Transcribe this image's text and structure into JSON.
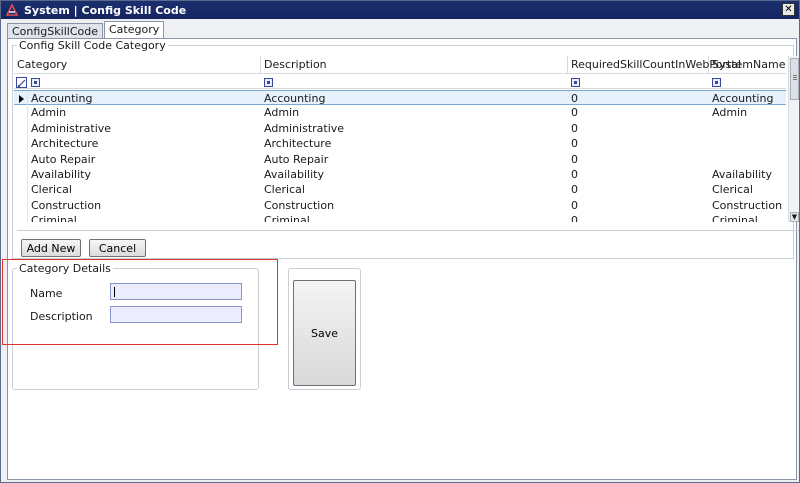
{
  "window": {
    "title": "System | Config Skill Code",
    "close_label": "✕"
  },
  "tabs": [
    {
      "label": "ConfigSkillCode"
    },
    {
      "label": "Category"
    }
  ],
  "grid_group": {
    "legend": "Config Skill Code Category",
    "columns": [
      "Category",
      "Description",
      "RequiredSkillCountInWebPortal",
      "SystemName"
    ],
    "rows": [
      [
        "Accounting",
        "Accounting",
        "0",
        "Accounting"
      ],
      [
        "Admin",
        "Admin",
        "0",
        "Admin"
      ],
      [
        "Administrative",
        "Administrative",
        "0",
        ""
      ],
      [
        "Architecture",
        "Architecture",
        "0",
        ""
      ],
      [
        "Auto Repair",
        "Auto Repair",
        "0",
        ""
      ],
      [
        "Availability",
        "Availability",
        "0",
        "Availability"
      ],
      [
        "Clerical",
        "Clerical",
        "0",
        "Clerical"
      ],
      [
        "Construction",
        "Construction",
        "0",
        "Construction"
      ],
      [
        "Criminal",
        "Criminal",
        "0",
        "Criminal"
      ]
    ],
    "selected_row": 0
  },
  "buttons": {
    "add_new": "Add New",
    "cancel": "Cancel",
    "save": "Save"
  },
  "details": {
    "legend": "Category Details",
    "name_label": "Name",
    "name_value": "",
    "description_label": "Description",
    "description_value": ""
  },
  "colors": {
    "title_bar": "#1c2f6e",
    "highlight": "#e03030",
    "input_bg": "#ececff"
  }
}
